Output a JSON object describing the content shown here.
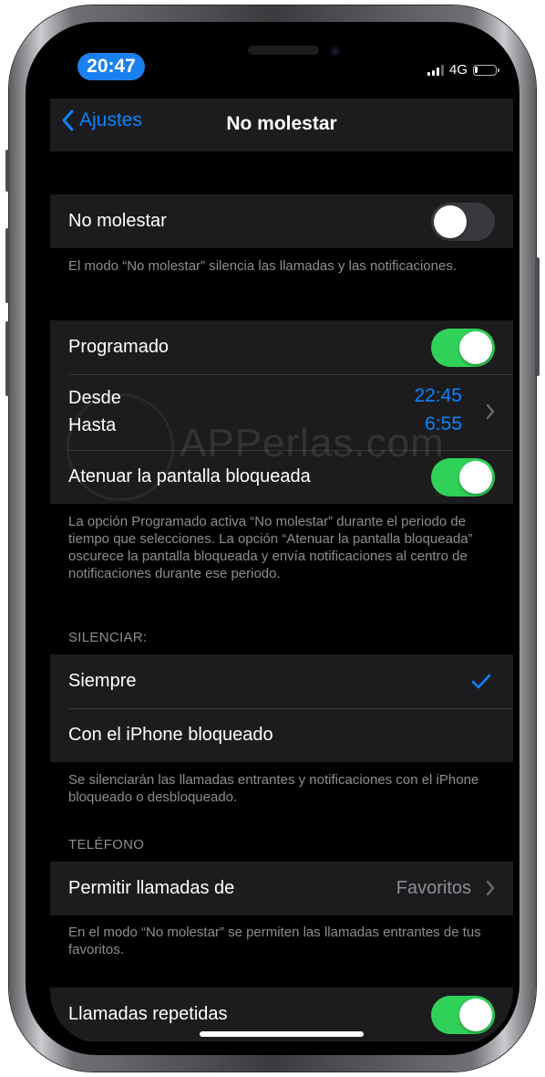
{
  "status_bar": {
    "time": "20:47",
    "network": "4G"
  },
  "nav": {
    "back_label": "Ajustes",
    "title": "No molestar"
  },
  "dnd": {
    "label": "No molestar",
    "toggle_on": false,
    "footer": "El modo “No molestar” silencia las llamadas y las notificaciones."
  },
  "schedule": {
    "label": "Programado",
    "toggle_on": true,
    "from_label": "Desde",
    "to_label": "Hasta",
    "from_value": "22:45",
    "to_value": "6:55",
    "dim_label": "Atenuar la pantalla bloqueada",
    "dim_toggle_on": true,
    "footer": "La opción Programado activa “No molestar” durante el periodo de tiempo que selecciones. La opción “Atenuar la pantalla bloqueada” oscurece la pantalla bloqueada y envía notificaciones al centro de notificaciones durante ese periodo."
  },
  "silence": {
    "header": "SILENCIAR:",
    "options": [
      "Siempre",
      "Con el iPhone bloqueado"
    ],
    "selected": "Siempre",
    "footer": "Se silenciarán las llamadas entrantes y notificaciones con el iPhone bloqueado o desbloqueado."
  },
  "phone": {
    "header": "TELÉFONO",
    "allow_calls_label": "Permitir llamadas de",
    "allow_calls_value": "Favoritos",
    "footer": "En el modo “No molestar” se permiten las llamadas entrantes de tus favoritos.",
    "repeated_label": "Llamadas repetidas",
    "repeated_toggle_on": true
  },
  "watermark": "APPerlas.com",
  "colors": {
    "accent": "#0a84ff",
    "toggle_on": "#30d158",
    "status_pill": "#1a80f0",
    "cell_bg": "#1c1c1e"
  }
}
